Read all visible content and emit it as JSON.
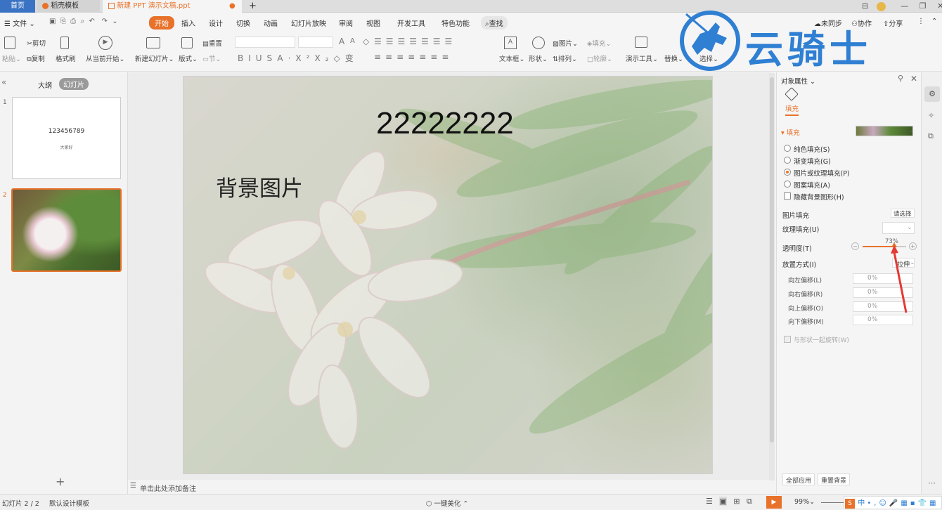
{
  "tabs": {
    "home": "首页",
    "template": "稻壳模板",
    "doc": "新建 PPT 演示文稿.ppt",
    "add": "+"
  },
  "menu": {
    "file": "文件",
    "items": [
      "开始",
      "插入",
      "设计",
      "切换",
      "动画",
      "幻灯片放映",
      "审阅",
      "视图",
      "开发工具",
      "特色功能"
    ],
    "search": "查找",
    "sync": "未同步",
    "collab": "协作",
    "share": "分享"
  },
  "ribbon": {
    "paste": "粘贴",
    "cut": "剪切",
    "copy": "复制",
    "format_painter": "格式刷",
    "from_current": "从当前开始",
    "new_slide": "新建幻灯片",
    "layout": "版式",
    "reset": "重置",
    "section": "节",
    "textbox": "文本框",
    "shape": "形状",
    "picture": "图片",
    "fill": "填充",
    "arrange": "排列",
    "outline": "轮廓",
    "present_tools": "演示工具",
    "replace": "替换",
    "select": "选择"
  },
  "watermark": {
    "text": "云骑士"
  },
  "left_pane": {
    "outline_tab": "大纲",
    "slides_tab": "幻灯片",
    "slide1_num": "1",
    "slide1_title": "123456789",
    "slide1_sub": "大家好",
    "slide2_num": "2",
    "add": "+"
  },
  "slide": {
    "title": "22222222",
    "text": "背景图片"
  },
  "notes": {
    "placeholder": "单击此处添加备注"
  },
  "right_pane": {
    "title": "对象属性",
    "tab_fill": "填充",
    "section_fill": "填充",
    "options": [
      "纯色填充(S)",
      "渐变填充(G)",
      "图片或纹理填充(P)",
      "图案填充(A)"
    ],
    "selected_option": "图片或纹理填充(P)",
    "hide_bg": "隐藏背景图形(H)",
    "pic_fill": "图片填充",
    "choose": "请选择",
    "texture_fill": "纹理填充(U)",
    "transparency_label": "透明度(T)",
    "transparency_value": "73%",
    "transparency_fraction": 0.73,
    "placement_label": "放置方式(I)",
    "placement_value": "拉伸",
    "offsets": [
      {
        "label": "向左偏移(L)",
        "value": "0%"
      },
      {
        "label": "向右偏移(R)",
        "value": "0%"
      },
      {
        "label": "向上偏移(O)",
        "value": "0%"
      },
      {
        "label": "向下偏移(M)",
        "value": "0%"
      }
    ],
    "rotate_with_shape": "与形状一起旋转(W)",
    "apply_all": "全部应用",
    "reset_bg": "重置背景"
  },
  "status": {
    "slide_count": "幻灯片 2 / 2",
    "template": "默认设计模板",
    "beautify": "一键美化",
    "zoom": "99%",
    "ime": "中"
  },
  "colors": {
    "accent": "#e8722a",
    "watermark": "#2f7fd3",
    "arrow": "#e53935"
  }
}
